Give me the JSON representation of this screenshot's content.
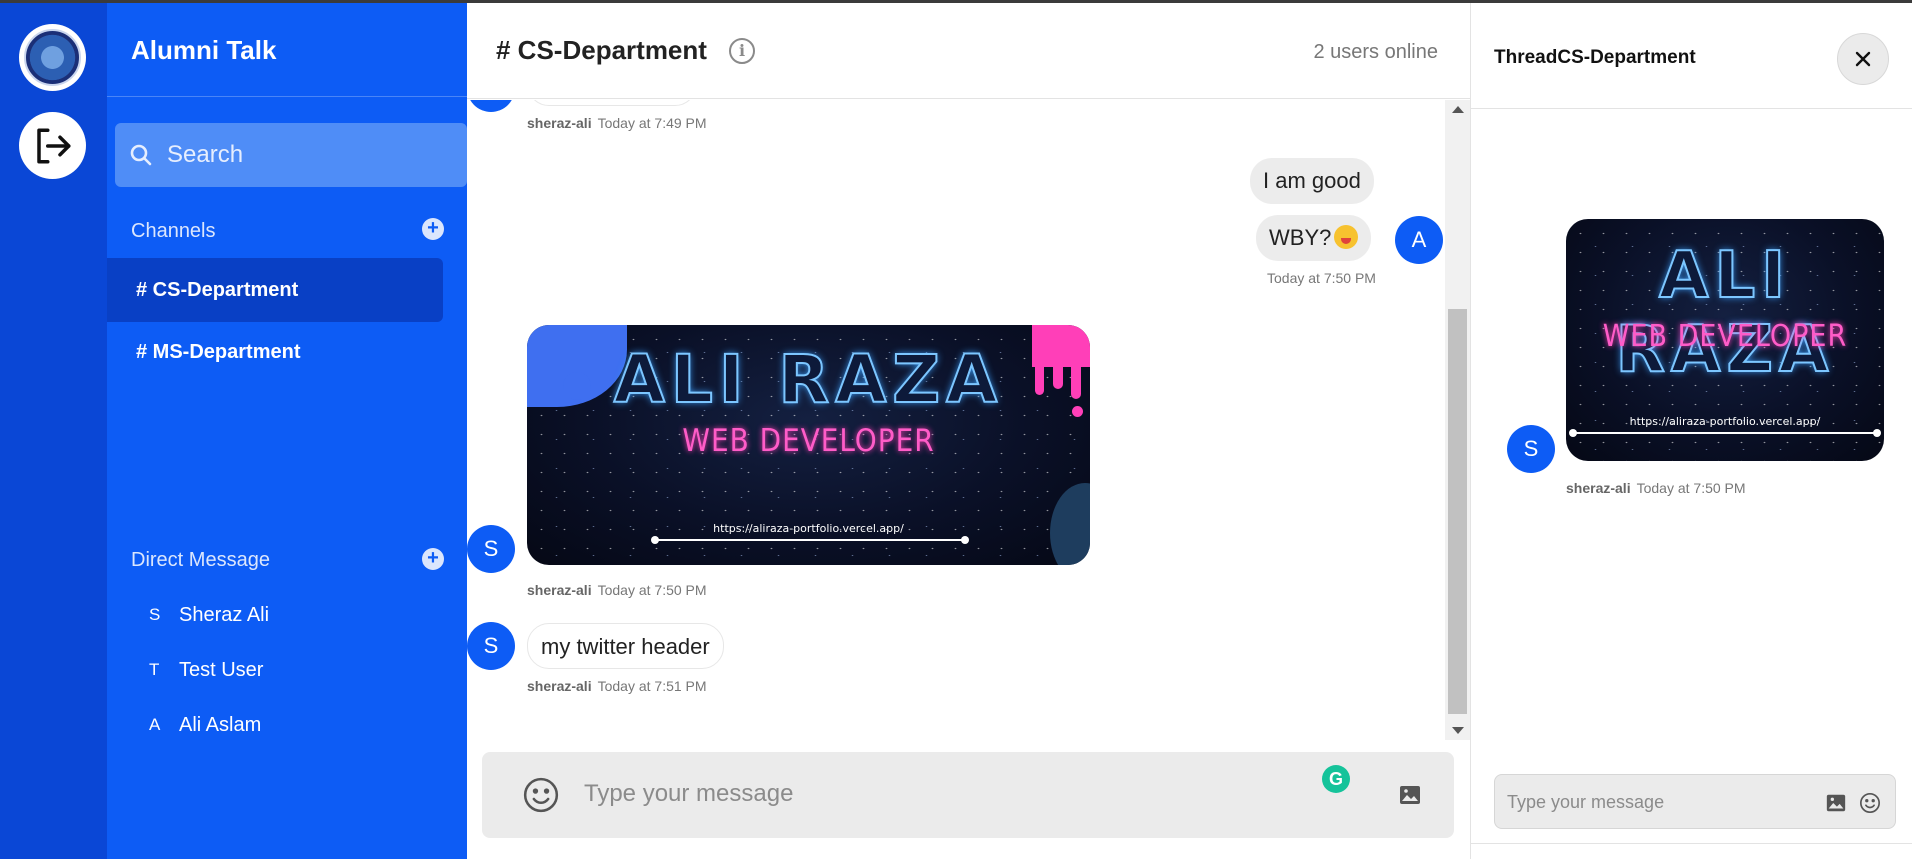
{
  "app": {
    "title": "Alumni Talk"
  },
  "rail": {
    "logo_icon": "university-logo-icon",
    "logout_icon": "logout-icon"
  },
  "search": {
    "placeholder": "Search"
  },
  "channels": {
    "heading": "Channels",
    "items": [
      {
        "label": "# CS-Department",
        "active": true
      },
      {
        "label": "# MS-Department",
        "active": false
      }
    ]
  },
  "direct_messages": {
    "heading": "Direct Message",
    "items": [
      {
        "initial": "S",
        "name": "Sheraz Ali"
      },
      {
        "initial": "T",
        "name": "Test User"
      },
      {
        "initial": "A",
        "name": "Ali Aslam"
      }
    ]
  },
  "chat": {
    "title": "# CS-Department",
    "online": "2 users online",
    "messages": [
      {
        "user": "sheraz-ali",
        "time": "Today at 7:49 PM"
      },
      {
        "initial": "A",
        "lines": [
          "I am good",
          "WBY?"
        ],
        "time": "Today at 7:50 PM"
      },
      {
        "initial": "S",
        "user": "sheraz-ali",
        "time": "Today at 7:50 PM"
      },
      {
        "initial": "S",
        "text": "my twitter header",
        "user": "sheraz-ali",
        "time": "Today at 7:51 PM"
      }
    ],
    "composer_placeholder": "Type your message"
  },
  "banner": {
    "name": "ALI RAZA",
    "role": "WEB DEVELOPER",
    "url": "https://aliraza-portfolio.vercel.app/"
  },
  "thread": {
    "title": "ThreadCS-Department",
    "message": {
      "initial": "S",
      "user": "sheraz-ali",
      "time": "Today at 7:50 PM"
    },
    "input_placeholder": "Type your message"
  },
  "colors": {
    "rail": "#0a47d6",
    "sidebar": "#0d5cf5",
    "active_channel": "#0940c5",
    "avatar": "#0d5cf5"
  }
}
